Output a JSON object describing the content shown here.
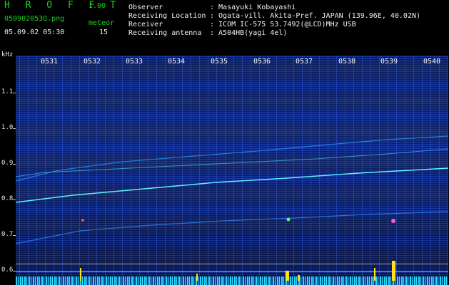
{
  "app": {
    "title": "H R O F F T",
    "version": "1.00"
  },
  "file": {
    "name": "050902053O.png",
    "timestamp": "05.09.02 05:30"
  },
  "meteor": {
    "label": "meteor",
    "count": "15"
  },
  "info": [
    {
      "key": "Observer",
      "value": ": Masayuki Kobayashi"
    },
    {
      "key": "Receiving Location",
      "value": ": Ogata-vill. Akita-Pref. JAPAN (139.96E, 40.02N)"
    },
    {
      "key": "Receiver",
      "value": ": ICOM IC-575 53.7492(@LCD)MHz USB"
    },
    {
      "key": "Receiving antenna",
      "value": ": A504HB(yagi 4el)"
    }
  ],
  "axis": {
    "unit": "kHz",
    "ticks": [
      "1.1",
      "1.0",
      "0.9",
      "0.8",
      "0.7",
      "0.6"
    ],
    "times": [
      "0531",
      "0532",
      "0533",
      "0534",
      "0535",
      "0536",
      "0537",
      "0538",
      "0539",
      "0540"
    ]
  },
  "colors": {
    "green": "#19d419",
    "white": "#f0f0f0",
    "plot_blue": "#183aa8",
    "trace": "#5ff0ff",
    "meteor_yellow": "#ffe21a"
  }
}
